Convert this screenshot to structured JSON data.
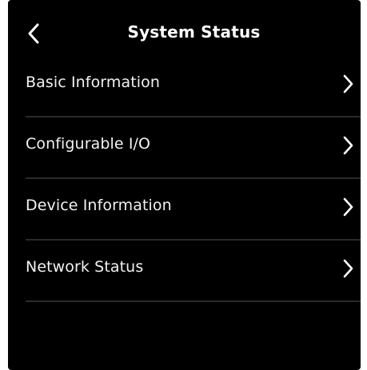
{
  "header": {
    "title": "System Status",
    "back_icon": "chevron-left-icon"
  },
  "menu": {
    "items": [
      {
        "label": "Basic Information",
        "icon": "chevron-right-icon"
      },
      {
        "label": "Configurable I/O",
        "icon": "chevron-right-icon"
      },
      {
        "label": "Device Information",
        "icon": "chevron-right-icon"
      },
      {
        "label": "Network Status",
        "icon": "chevron-right-icon"
      }
    ]
  },
  "colors": {
    "background": "#000000",
    "text": "#ffffff",
    "divider": "#2a2a2a"
  }
}
